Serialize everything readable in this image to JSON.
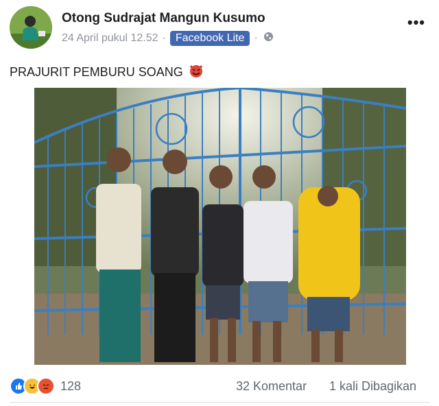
{
  "post": {
    "author": "Otong Sudrajat Mangun Kusumo",
    "timestamp": "24 April pukul 12.52",
    "separator": "·",
    "app_badge": "Facebook Lite",
    "privacy_icon": "globe-icon",
    "more_label": "•••",
    "text": "PRAJURIT PEMBURU SOANG"
  },
  "footer": {
    "reactions": [
      "like",
      "haha",
      "angry"
    ],
    "reaction_count": "128",
    "comments": "32 Komentar",
    "shares": "1 kali Dibagikan"
  },
  "colors": {
    "brand": "#4267b2",
    "like": "#1877f2",
    "gate": "#3a7fc1"
  }
}
